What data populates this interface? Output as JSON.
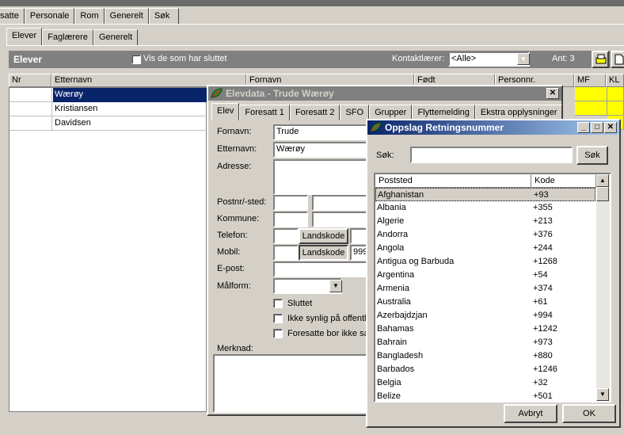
{
  "main_tabs": [
    "satte",
    "Personale",
    "Rom",
    "Generelt",
    "Søk"
  ],
  "sub_tabs": [
    "Elever",
    "Faglærere",
    "Generelt"
  ],
  "panel": {
    "title": "Elever",
    "show_left_label": "Vis de som har sluttet",
    "contact_label": "Kontaktlærer:",
    "contact_value": "<Alle>",
    "count_label": "Ant: 3"
  },
  "grid": {
    "columns": [
      "Nr",
      "Etternavn",
      "Fornavn",
      "Født",
      "Personnr.",
      "MF",
      "KL"
    ],
    "rows": [
      {
        "nr": "",
        "etternavn": "Wærøy"
      },
      {
        "nr": "",
        "etternavn": "Kristiansen"
      },
      {
        "nr": "",
        "etternavn": "Davidsen"
      }
    ]
  },
  "elevdata": {
    "title": "Elevdata - Trude Wærøy",
    "tabs": [
      "Elev",
      "Foresatt 1",
      "Foresatt 2",
      "SFO",
      "Grupper",
      "Flyttemelding",
      "Ekstra opplysninger"
    ],
    "labels": {
      "fornavn": "Fornavn:",
      "etternavn": "Etternavn:",
      "adresse": "Adresse:",
      "postnr": "Postnr/-sted:",
      "kommune": "Kommune:",
      "telefon": "Telefon:",
      "mobil": "Mobil:",
      "epost": "E-post:",
      "malform": "Målform:",
      "merknad": "Merknad:"
    },
    "values": {
      "fornavn": "Trude",
      "etternavn": "Wærøy",
      "mobil_extra": "999"
    },
    "landskode": "Landskode",
    "checks": [
      "Sluttet",
      "Ikke synlig på offentl",
      "Foresatte bor ikke sa"
    ]
  },
  "oppslag": {
    "title": "Oppslag Retningsnummer",
    "search_label": "Søk:",
    "search_value": "",
    "search_button": "Søk",
    "columns": [
      "Poststed",
      "Kode"
    ],
    "rows": [
      {
        "name": "Afghanistan",
        "code": "+93"
      },
      {
        "name": "Albania",
        "code": "+355"
      },
      {
        "name": "Algerie",
        "code": "+213"
      },
      {
        "name": "Andorra",
        "code": "+376"
      },
      {
        "name": "Angola",
        "code": "+244"
      },
      {
        "name": "Antigua og Barbuda",
        "code": "+1268"
      },
      {
        "name": "Argentina",
        "code": "+54"
      },
      {
        "name": "Armenia",
        "code": "+374"
      },
      {
        "name": "Australia",
        "code": "+61"
      },
      {
        "name": "Azerbajdzjan",
        "code": "+994"
      },
      {
        "name": "Bahamas",
        "code": "+1242"
      },
      {
        "name": "Bahrain",
        "code": "+973"
      },
      {
        "name": "Bangladesh",
        "code": "+880"
      },
      {
        "name": "Barbados",
        "code": "+1246"
      },
      {
        "name": "Belgia",
        "code": "+32"
      },
      {
        "name": "Belize",
        "code": "+501"
      }
    ],
    "cancel": "Avbryt",
    "ok": "OK"
  },
  "colors": {
    "selection": "#0a246a",
    "highlight": "#ffff00"
  }
}
